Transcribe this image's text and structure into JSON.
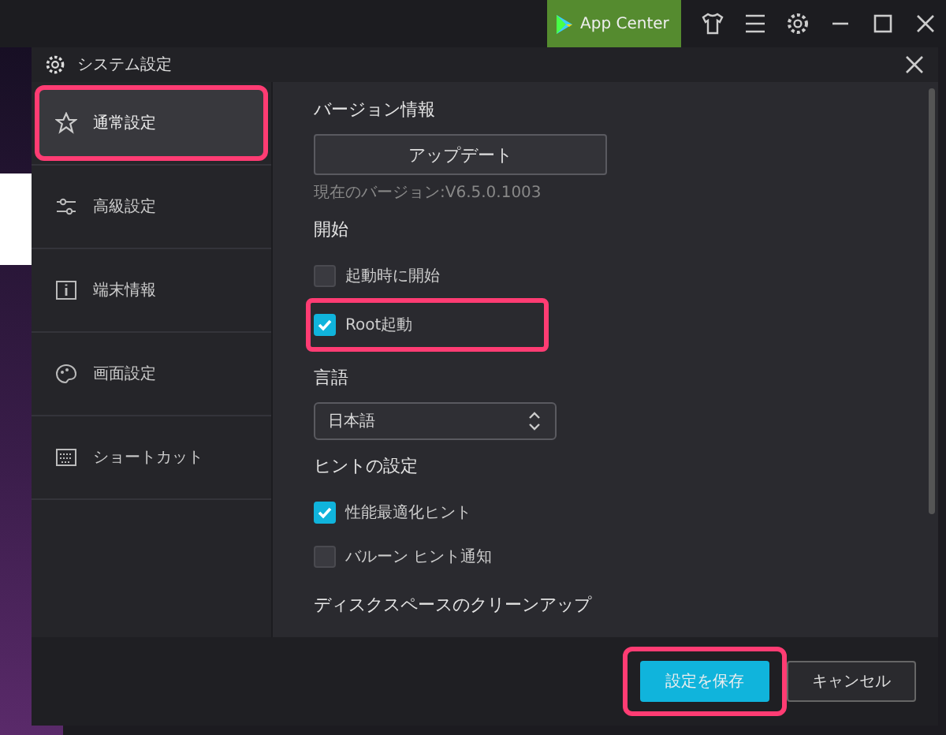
{
  "top_bar": {
    "app_center": "App Center"
  },
  "dialog": {
    "title": "システム設定",
    "sidebar": [
      {
        "label": "通常設定",
        "selected": true,
        "highlighted": true
      },
      {
        "label": "高級設定",
        "selected": false,
        "highlighted": false
      },
      {
        "label": "端末情報",
        "selected": false,
        "highlighted": false
      },
      {
        "label": "画面設定",
        "selected": false,
        "highlighted": false
      },
      {
        "label": "ショートカット",
        "selected": false,
        "highlighted": false
      }
    ],
    "sections": [
      {
        "kind": "version",
        "heading": "バージョン情報",
        "button": "アップデート",
        "note": "現在のバージョン:V6.5.0.1003"
      },
      {
        "kind": "checks",
        "heading": "開始",
        "items": [
          {
            "label": "起動時に開始",
            "checked": false,
            "highlighted": false
          },
          {
            "label": "Root起動",
            "checked": true,
            "highlighted": true
          }
        ]
      },
      {
        "kind": "select",
        "heading": "言語",
        "value": "日本語"
      },
      {
        "kind": "checks",
        "heading": "ヒントの設定",
        "items": [
          {
            "label": "性能最適化ヒント",
            "checked": true,
            "highlighted": false
          },
          {
            "label": "バルーン ヒント通知",
            "checked": false,
            "highlighted": false
          }
        ]
      },
      {
        "kind": "heading",
        "heading": "ディスクスペースのクリーンアップ"
      }
    ],
    "buttons": [
      {
        "label": "設定を保存",
        "kind": "primary",
        "highlighted": true
      },
      {
        "label": "キャンセル",
        "kind": "secondary",
        "highlighted": false
      }
    ]
  }
}
